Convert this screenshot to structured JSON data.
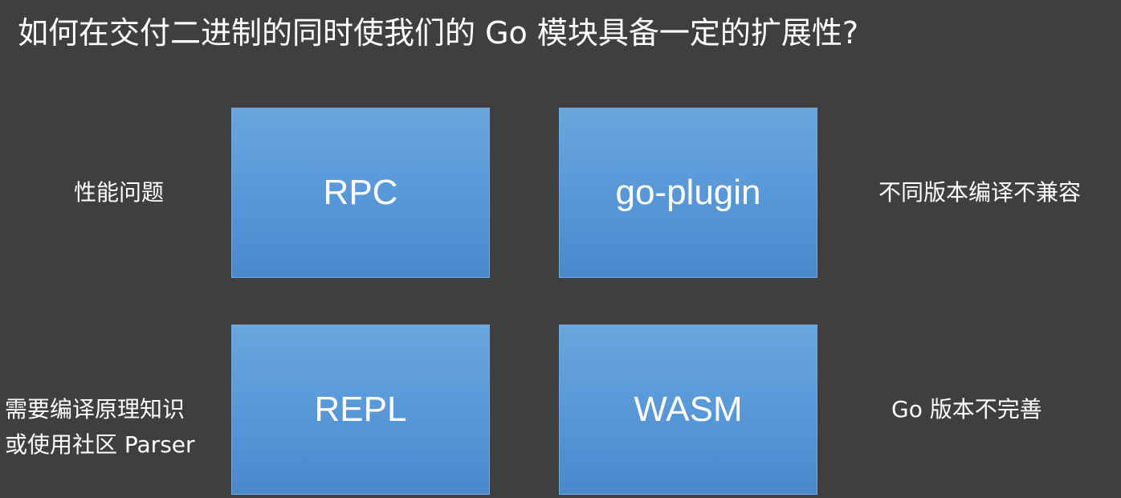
{
  "slide": {
    "title": "如何在交付二进制的同时使我们的 Go 模块具备一定的扩展性?",
    "options": [
      {
        "id": "rpc",
        "label": "RPC",
        "note_lines": [
          "性能问题"
        ]
      },
      {
        "id": "go-plugin",
        "label": "go-plugin",
        "note_lines": [
          "不同版本编译不兼容"
        ]
      },
      {
        "id": "repl",
        "label": "REPL",
        "note_lines": [
          "需要编译原理知识",
          "或使用社区 Parser"
        ]
      },
      {
        "id": "wasm",
        "label": "WASM",
        "note_lines": [
          "Go 版本不完善"
        ]
      }
    ]
  },
  "colors": {
    "background": "#3f3f3f",
    "box_top": "#6aa6dd",
    "box_bottom": "#4a88cc",
    "box_border": "#7aa7d8",
    "text": "#ffffff"
  }
}
